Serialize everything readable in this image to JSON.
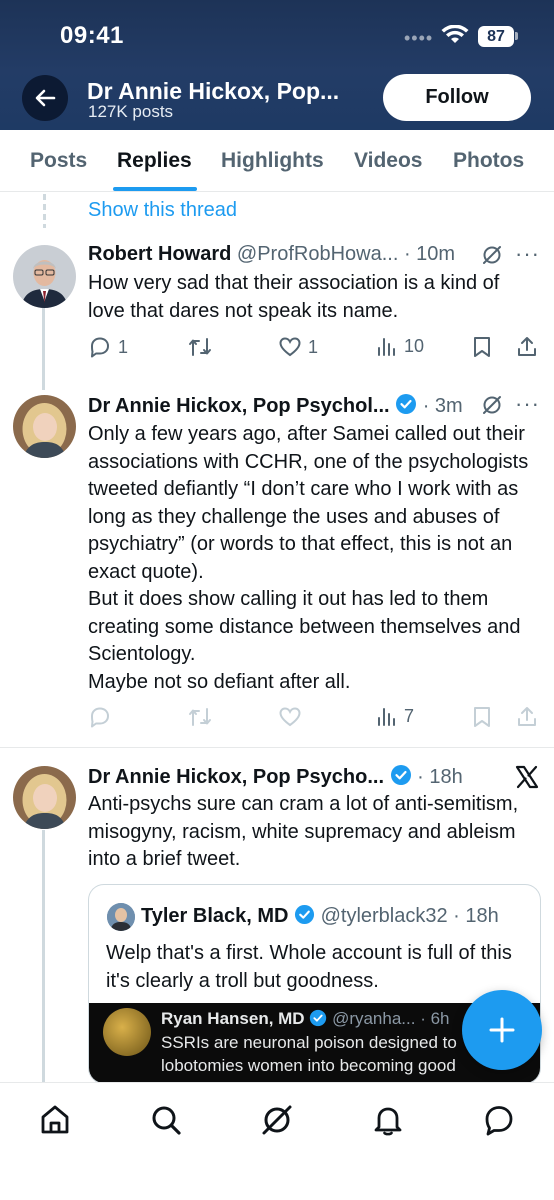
{
  "status_bar": {
    "time": "09:41",
    "battery": "87"
  },
  "header": {
    "profile_name": "Dr Annie Hickox, Pop...",
    "posts_count": "127K posts",
    "follow_label": "Follow"
  },
  "tabs": [
    {
      "label": "Posts",
      "active": false
    },
    {
      "label": "Replies",
      "active": true
    },
    {
      "label": "Highlights",
      "active": false
    },
    {
      "label": "Videos",
      "active": false
    },
    {
      "label": "Photos",
      "active": false
    }
  ],
  "show_thread": "Show this thread",
  "posts": [
    {
      "name": "Robert Howard",
      "meta": "@ProfRobHowa... · 10m",
      "text": "How very sad that their association is a kind of love that dares not speak its name.",
      "replies": "1",
      "reposts": "",
      "likes": "1",
      "views": "10"
    },
    {
      "name": "Dr Annie Hickox, Pop Psychol...",
      "meta": "· 3m",
      "verified": true,
      "text_lines": [
        "Only a few years ago, after Samei called out their associations with CCHR, one of the psychologists tweeted defiantly “I don’t care who I work with as long as they challenge the uses and abuses of psychiatry” (or words to that effect, this is not an exact quote).",
        "But it does show calling it out has led to them creating some distance between themselves and Scientology.",
        "Maybe not so defiant after all."
      ],
      "views": "7"
    },
    {
      "name": "Dr Annie Hickox, Pop Psycho...",
      "meta": "· 18h",
      "verified": true,
      "text": "Anti-psychs sure can cram a lot of anti-semitism, misogyny, racism, white supremacy and ableism into a brief tweet.",
      "quote": {
        "name": "Tyler Black, MD",
        "meta": "@tylerblack32 · 18h",
        "text": "Welp that's a first. Whole account is full of this it's clearly a troll but goodness.",
        "media_name": "Ryan Hansen, MD",
        "media_meta": "@ryanha... · 6h",
        "media_text": "SSRIs are neuronal poison designed to lobotomies women into becoming good"
      }
    }
  ],
  "colors": {
    "accent": "#1d9bf0",
    "header_bg": "#233c66",
    "text": "#0f1419",
    "muted": "#536471"
  }
}
